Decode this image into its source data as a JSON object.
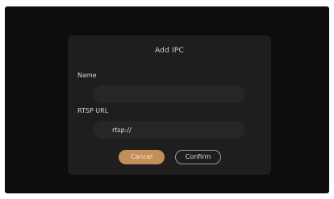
{
  "dialog": {
    "title": "Add IPC",
    "name_label": "Name",
    "name_value": "",
    "url_label": "RTSP URL",
    "url_value": "rtsp://",
    "cancel_label": "Cancel",
    "confirm_label": "Confirm"
  },
  "colors": {
    "screen_bg": "#0d0d0d",
    "dialog_bg": "#1e1e1f",
    "input_bg": "#262627",
    "accent": "#c38f59"
  }
}
